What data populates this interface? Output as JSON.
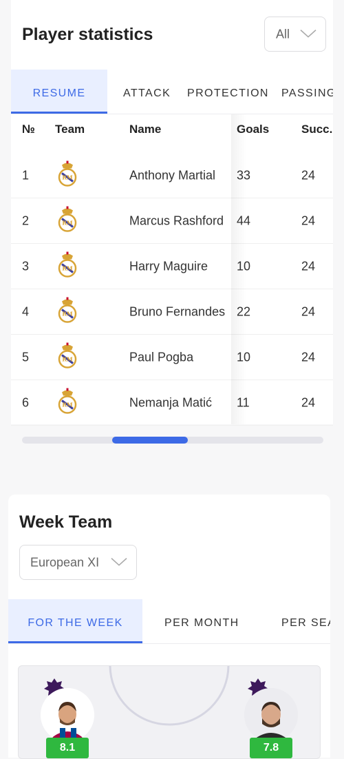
{
  "stats": {
    "title": "Player statistics",
    "filter_value": "All",
    "tabs": [
      {
        "label": "RESUME",
        "active": true
      },
      {
        "label": "ATTACK",
        "active": false
      },
      {
        "label": "PROTECTION",
        "active": false
      },
      {
        "label": "PASSING",
        "active": false
      }
    ],
    "columns": [
      "№",
      "Team",
      "Name",
      "Goals",
      "Succ."
    ],
    "rows": [
      {
        "num": "1",
        "name": "Anthony Martial",
        "goals": "33",
        "succ": "24"
      },
      {
        "num": "2",
        "name": "Marcus Rashford",
        "goals": "44",
        "succ": "24"
      },
      {
        "num": "3",
        "name": "Harry Maguire",
        "goals": "10",
        "succ": "24"
      },
      {
        "num": "4",
        "name": "Bruno Fernandes",
        "goals": "22",
        "succ": "24"
      },
      {
        "num": "5",
        "name": "Paul Pogba",
        "goals": "10",
        "succ": "24"
      },
      {
        "num": "6",
        "name": "Nemanja Matić",
        "goals": "11",
        "succ": "24"
      }
    ],
    "team_icon": "real-madrid-crest-icon",
    "scroll_position_fraction": 0.4
  },
  "week_team": {
    "title": "Week Team",
    "filter_value": "European XI",
    "tabs": [
      {
        "label": "FOR THE WEEK",
        "active": true
      },
      {
        "label": "PER MONTH",
        "active": false
      },
      {
        "label": "PER SEA",
        "active": false
      }
    ],
    "players": [
      {
        "rating": "8.1",
        "league_icon": "premier-league-icon"
      },
      {
        "rating": "7.8",
        "league_icon": "premier-league-icon"
      }
    ]
  },
  "colors": {
    "accent": "#3d6ae6",
    "active_tab_bg": "#e9efff",
    "rating_green": "#2fb83f",
    "league_purple": "#3d195b"
  }
}
